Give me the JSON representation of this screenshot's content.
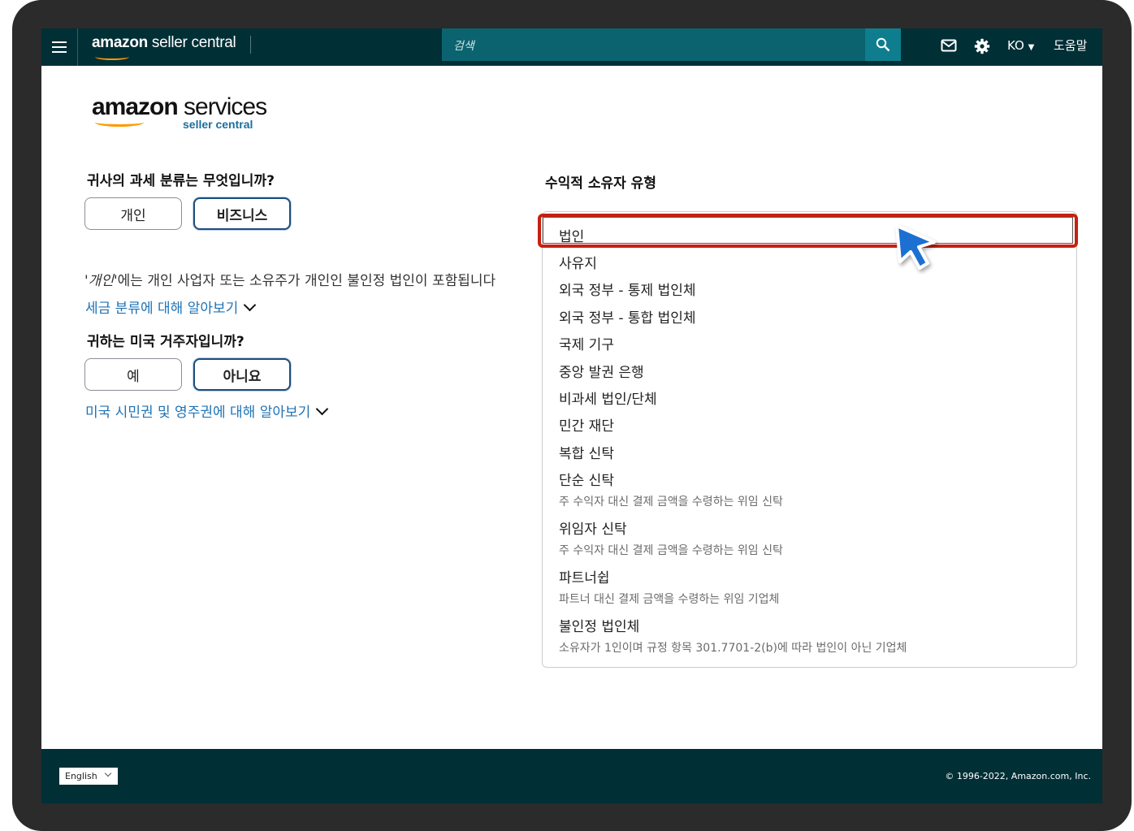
{
  "topbar": {
    "brand_bold": "amazon",
    "brand_rest": " seller central",
    "search_placeholder": "검색",
    "language": "KO",
    "help": "도움말"
  },
  "logo": {
    "line1_bold": "amazon",
    "line1_rest": " services",
    "line2": "seller central"
  },
  "left": {
    "q1": "귀사의 과세 분류는 무엇입니까?",
    "q1_options": [
      "개인",
      "비즈니스"
    ],
    "q1_selected": "비즈니스",
    "note_italic": "'개인'",
    "note_rest": "에는 개인 사업자 또는 소유주가 개인인 불인정 법인이 포함됩니다",
    "link1": "세금 분류에 대해 알아보기",
    "q2": "귀하는 미국 거주자입니까?",
    "q2_options": [
      "예",
      "아니요"
    ],
    "q2_selected": "아니요",
    "link2": "미국 시민권 및 영주권에 대해 알아보기"
  },
  "right": {
    "title": "수익적 소유자 유형",
    "options": [
      {
        "label": "법인",
        "highlighted": true
      },
      {
        "label": "사유지"
      },
      {
        "label": "외국 정부 - 통제 법인체"
      },
      {
        "label": "외국 정부 - 통합 법인체"
      },
      {
        "label": "국제 기구"
      },
      {
        "label": "중앙 발권 은행"
      },
      {
        "label": "비과세 법인/단체"
      },
      {
        "label": "민간 재단"
      },
      {
        "label": "복합 신탁"
      },
      {
        "label": "단순 신탁",
        "sub": "주 수익자 대신 결제 금액을 수령하는 위임 신탁"
      },
      {
        "label": "위임자 신탁",
        "sub": "주 수익자 대신 결제 금액을 수령하는 위임 신탁"
      },
      {
        "label": "파트너쉽",
        "sub": "파트너 대신 결제 금액을 수령하는 위임 기업체"
      },
      {
        "label": "불인정 법인체",
        "sub": "소유자가 1인이며 규정 항목 301.7701-2(b)에 따라 법인이 아닌 기업체"
      }
    ]
  },
  "footer": {
    "language_select": "English",
    "copyright": "© 1996-2022, Amazon.com, Inc."
  },
  "colors": {
    "topbar": "#002f36",
    "search": "#0b6370",
    "link": "#1e73b5",
    "highlight": "#c8200e",
    "selected_border": "#1d4e7d"
  }
}
